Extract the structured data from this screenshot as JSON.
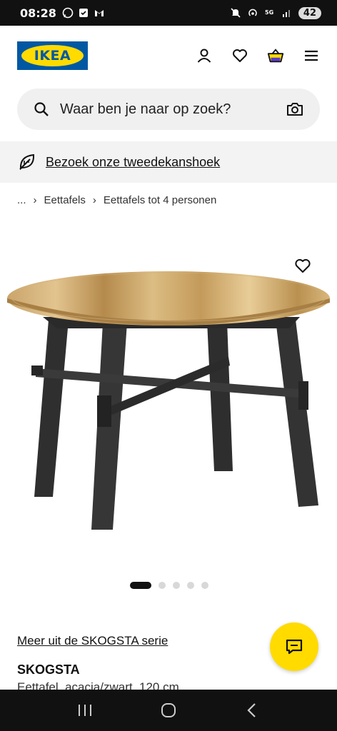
{
  "status": {
    "time": "08:28",
    "battery": "42",
    "left_icons": [
      "whatsapp-icon",
      "check-icon",
      "gmail-icon"
    ],
    "right_icons": [
      "mute-icon",
      "hotspot-icon",
      "5g-icon",
      "signal-icon"
    ]
  },
  "header": {
    "logo_text": "IKEA",
    "icons": [
      "user-icon",
      "heart-icon",
      "basket-icon",
      "menu-icon"
    ]
  },
  "search": {
    "placeholder": "Waar ben je naar op zoek?"
  },
  "banner": {
    "link_text": "Bezoek onze tweedekanshoek"
  },
  "breadcrumb": {
    "items": [
      "...",
      "Eettafels",
      "Eettafels tot 4 personen"
    ]
  },
  "product": {
    "series_link": "Meer uit de SKOGSTA serie",
    "name": "SKOGSTA",
    "description": "Eettafel, acacia/zwart, 120 cm",
    "image_count": 5,
    "active_image": 1
  },
  "colors": {
    "ikea_blue": "#0058a3",
    "ikea_yellow": "#ffdb00"
  }
}
